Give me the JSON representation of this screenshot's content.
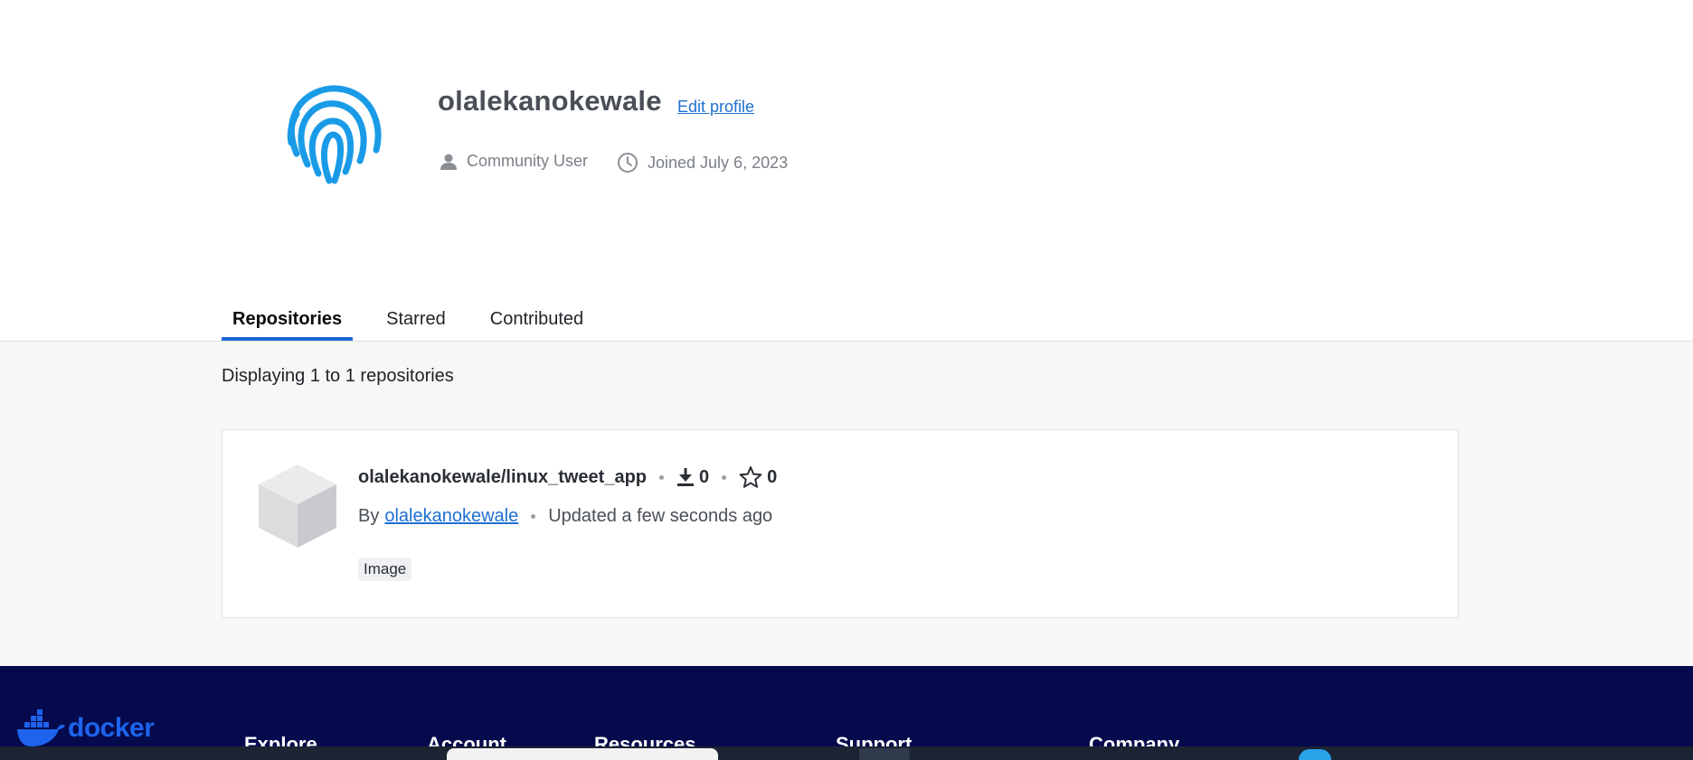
{
  "profile": {
    "username": "olalekanokewale",
    "edit_label": "Edit profile",
    "user_type": "Community User",
    "joined": "Joined July 6, 2023",
    "avatar_color": "#1a9be8"
  },
  "tabs": [
    {
      "label": "Repositories",
      "active": true
    },
    {
      "label": "Starred",
      "active": false
    },
    {
      "label": "Contributed",
      "active": false
    }
  ],
  "list": {
    "count_text": "Displaying 1 to 1 repositories"
  },
  "repositories": [
    {
      "name": "olalekanokewale/linux_tweet_app",
      "downloads": "0",
      "stars": "0",
      "by_label": "By",
      "owner": "olalekanokewale",
      "updated": "Updated a few seconds ago",
      "badge": "Image"
    }
  ],
  "footer": {
    "brand": "docker",
    "columns": [
      "Explore",
      "Account",
      "Resources",
      "Support",
      "Company"
    ],
    "background": "#050a4c",
    "brand_color": "#1d63ed"
  }
}
